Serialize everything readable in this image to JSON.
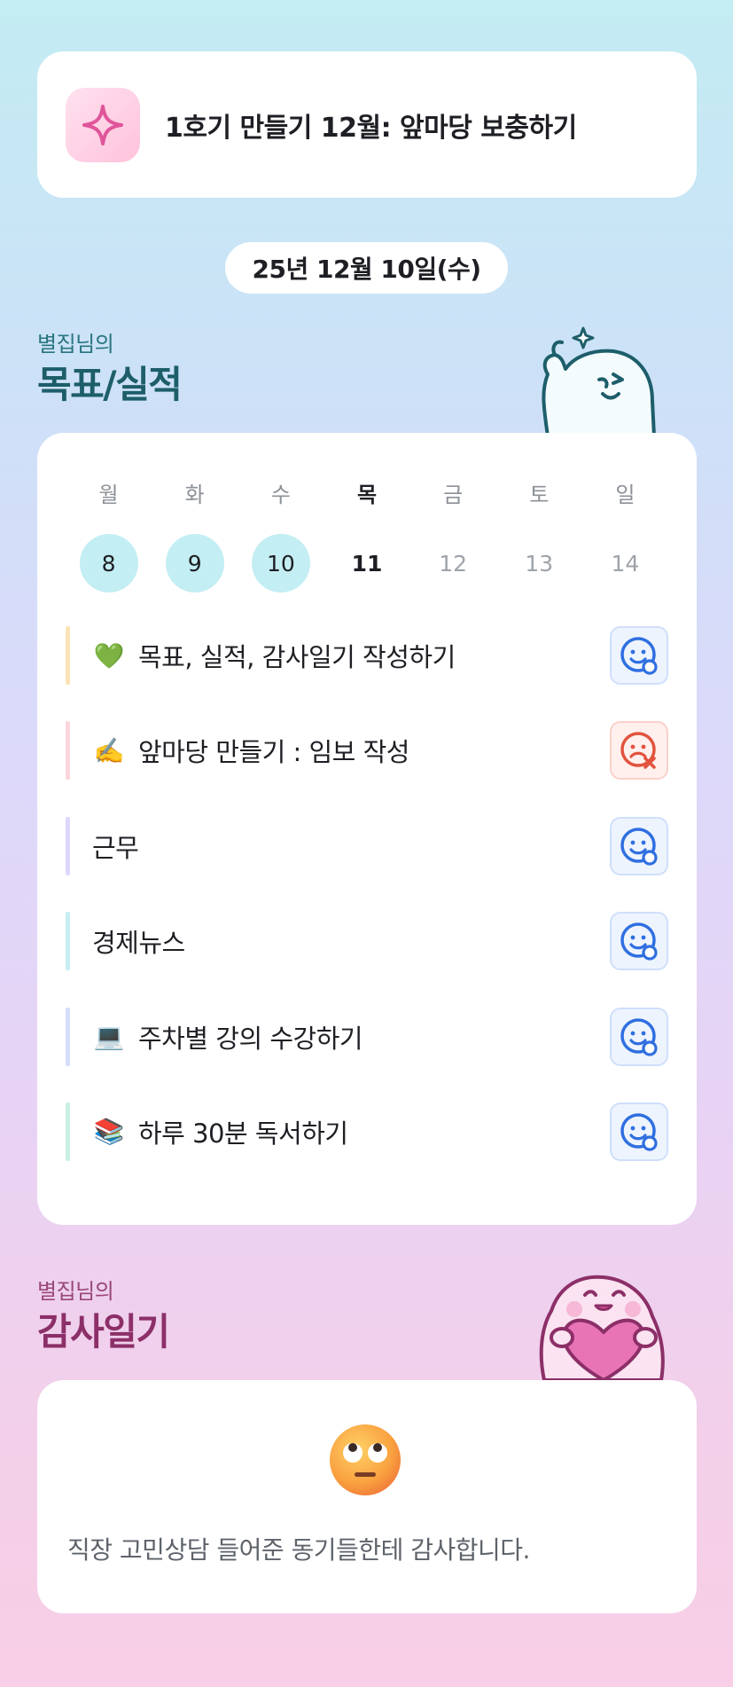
{
  "banner": {
    "text": "1호기 만들기 12월: 앞마당 보충하기",
    "icon": "sparkle-icon"
  },
  "date": "25년 12월 10일(수)",
  "goals_section": {
    "subtitle": "별집님의",
    "title": "목표/실적"
  },
  "week": {
    "days": [
      {
        "label": "월",
        "num": "8",
        "state": "done"
      },
      {
        "label": "화",
        "num": "9",
        "state": "done"
      },
      {
        "label": "수",
        "num": "10",
        "state": "done"
      },
      {
        "label": "목",
        "num": "11",
        "state": "today"
      },
      {
        "label": "금",
        "num": "12",
        "state": "future"
      },
      {
        "label": "토",
        "num": "13",
        "state": "future"
      },
      {
        "label": "일",
        "num": "14",
        "state": "future"
      }
    ]
  },
  "goals": [
    {
      "emoji": "💚",
      "text": "목표, 실적, 감사일기 작성하기",
      "status": "ok",
      "bar_color": "#fde3b8"
    },
    {
      "emoji": "✍️",
      "text": "앞마당 만들기 : 임보 작성",
      "status": "fail",
      "bar_color": "#fcd6dc"
    },
    {
      "emoji": "",
      "text": "근무",
      "status": "ok",
      "bar_color": "#dcd7fb"
    },
    {
      "emoji": "",
      "text": "경제뉴스",
      "status": "ok",
      "bar_color": "#c6eef3"
    },
    {
      "emoji": "💻",
      "text": "주차별 강의 수강하기",
      "status": "ok",
      "bar_color": "#d6defa"
    },
    {
      "emoji": "📚",
      "text": "하루 30분 독서하기",
      "status": "ok",
      "bar_color": "#c9f0e2"
    }
  ],
  "diary_section": {
    "subtitle": "별집님의",
    "title": "감사일기"
  },
  "diary": {
    "emoji": "face-with-rolling-eyes",
    "text": "직장 고민상담 들어준 동기들한테 감사합니다."
  },
  "colors": {
    "ok": "#2f6fe0",
    "fail": "#e2533e",
    "done_day": "#c3eef3"
  }
}
